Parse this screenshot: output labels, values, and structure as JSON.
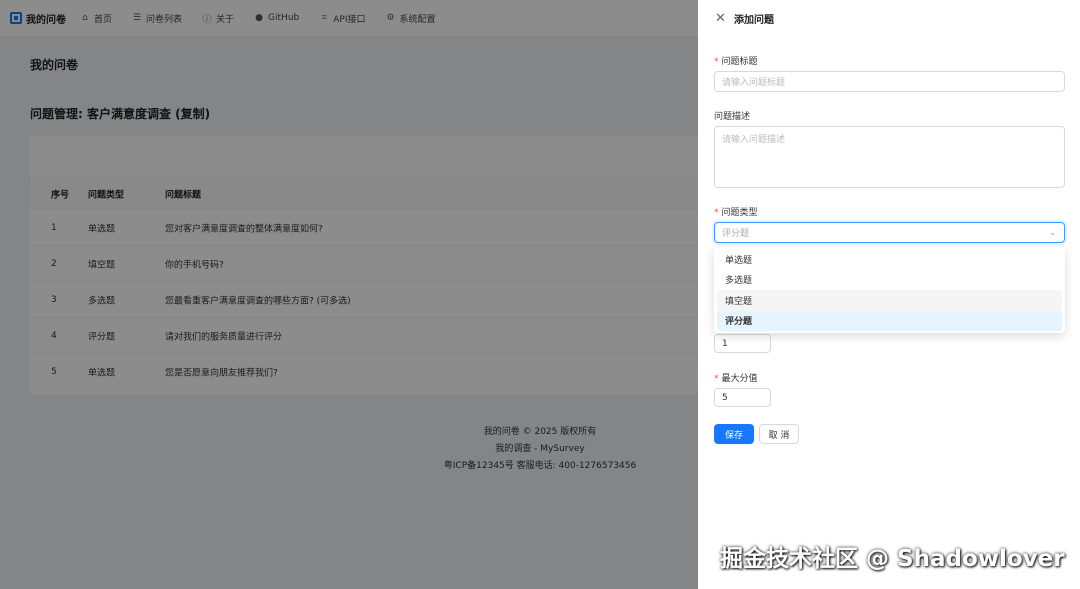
{
  "nav": {
    "brand": "我的问卷",
    "items": [
      {
        "label": "首页",
        "icon": "home-icon",
        "glyph": "⌂"
      },
      {
        "label": "问卷列表",
        "icon": "list-icon",
        "glyph": "☰"
      },
      {
        "label": "关于",
        "icon": "info-icon",
        "glyph": "ⓘ"
      },
      {
        "label": "GitHub",
        "icon": "github-icon",
        "glyph": "●"
      },
      {
        "label": "API接口",
        "icon": "api-icon",
        "glyph": "⌗"
      },
      {
        "label": "系统配置",
        "icon": "tool-icon",
        "glyph": "⚙"
      }
    ]
  },
  "main": {
    "app_title": "我的问卷",
    "page_heading": "问题管理: 客户满意度调查 (复制)",
    "table": {
      "columns": [
        "序号",
        "问题类型",
        "问题标题"
      ],
      "rows": [
        [
          "1",
          "单选题",
          "您对客户满意度调查的整体满意度如何?"
        ],
        [
          "2",
          "填空题",
          "你的手机号码?"
        ],
        [
          "3",
          "多选题",
          "您最看重客户满意度调查的哪些方面? (可多选)"
        ],
        [
          "4",
          "评分题",
          "请对我们的服务质量进行评分"
        ],
        [
          "5",
          "单选题",
          "您是否愿意向朋友推荐我们?"
        ]
      ]
    }
  },
  "footer": {
    "line1": "我的问卷 © 2025 版权所有",
    "line2": "我的调查 - MySurvey",
    "line3": "粤ICP备12345号    客服电话: 400-1276573456"
  },
  "drawer": {
    "title": "添加问题",
    "title_label": "问题标题",
    "title_placeholder": "请输入问题标题",
    "desc_label": "问题描述",
    "desc_placeholder": "请输入问题描述",
    "type_label": "问题类型",
    "type_value": "评分题",
    "type_options": [
      "单选题",
      "多选题",
      "填空题",
      "评分题"
    ],
    "min_value": "1",
    "max_label": "最大分值",
    "max_value": "5",
    "save_label": "保存",
    "cancel_label": "取 消"
  },
  "credit": "掘金技术社区 @ Shadowlover",
  "colors": {
    "primary": "#1677ff",
    "required": "#ff4d4f",
    "mask": "rgba(0,0,0,0.45)"
  }
}
